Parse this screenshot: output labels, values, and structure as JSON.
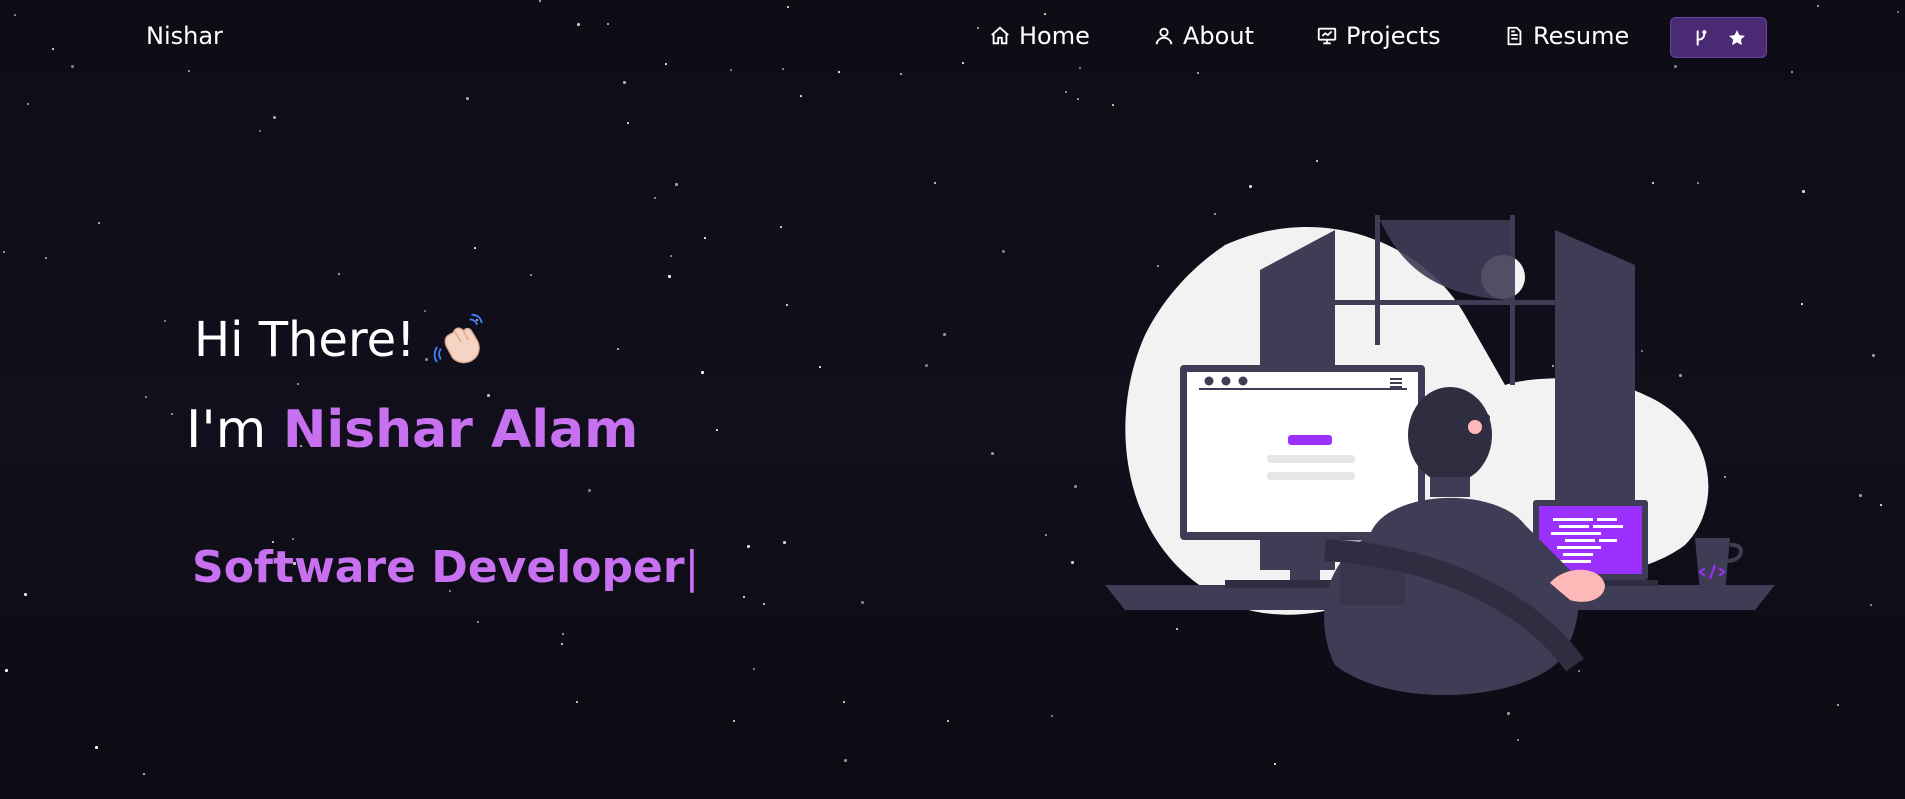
{
  "navbar": {
    "brand": "Nishar",
    "items": [
      {
        "label": "Home",
        "icon": "home-icon"
      },
      {
        "label": "About",
        "icon": "user-icon"
      },
      {
        "label": "Projects",
        "icon": "projects-icon"
      },
      {
        "label": "Resume",
        "icon": "document-icon"
      }
    ],
    "github_button": {
      "icons": [
        "fork-icon",
        "star-icon"
      ]
    }
  },
  "hero": {
    "greeting": "Hi There!",
    "greeting_emoji": "waving-hand-icon",
    "intro_prefix": "I'm",
    "name": "Nishar Alam",
    "typed_text": "Software Developer",
    "typed_cursor": "|"
  },
  "colors": {
    "accent": "#c770f0",
    "background": "#0f0e17",
    "button_bg": "#4a2a75",
    "laptop_screen": "#9b30ff"
  }
}
